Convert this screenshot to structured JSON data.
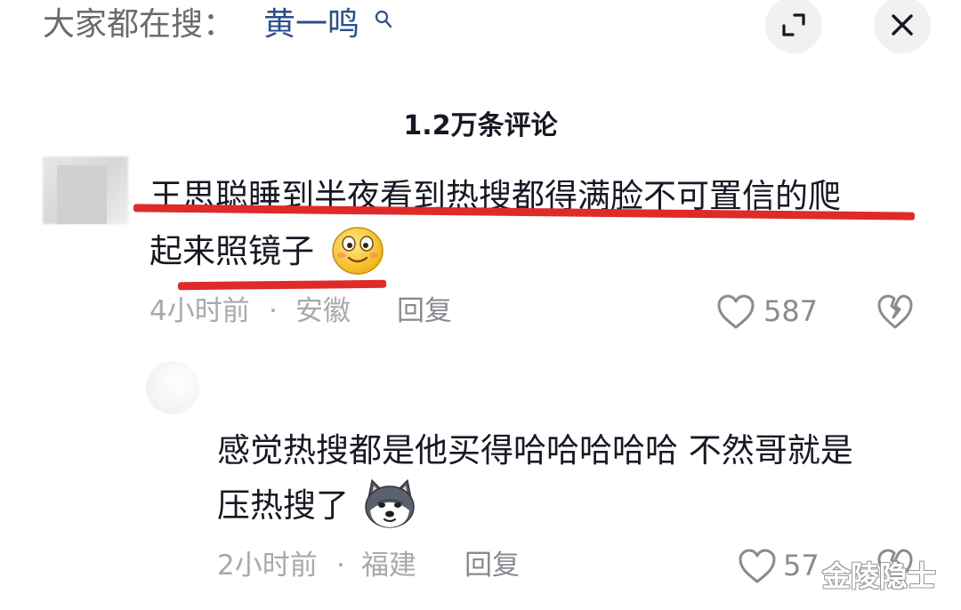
{
  "search_hint": {
    "prefix": "大家都在搜：",
    "term": "黄一鸣"
  },
  "header": {
    "comment_count": "1.2万条评论"
  },
  "comments": [
    {
      "text_line1": "王思聪睡到半夜看到热搜都得满脸不可置信的爬",
      "text_line2": "起来照镜子",
      "emoji": "smile-emoji",
      "time": "4小时前",
      "separator": "·",
      "location": "安徽",
      "reply_label": "回复",
      "likes": "587"
    },
    {
      "text_line1": "感觉热搜都是他买得哈哈哈哈哈 不然哥就是",
      "text_line2": "压热搜了",
      "emoji": "husky-dog-emoji",
      "time": "2小时前",
      "separator": "·",
      "location": "福建",
      "reply_label": "回复",
      "likes": "57"
    }
  ],
  "watermark": "金陵隐士",
  "colors": {
    "link_blue": "#2a4f8d",
    "underline_red": "#e02a2a",
    "meta_gray": "#a8a8ad"
  }
}
